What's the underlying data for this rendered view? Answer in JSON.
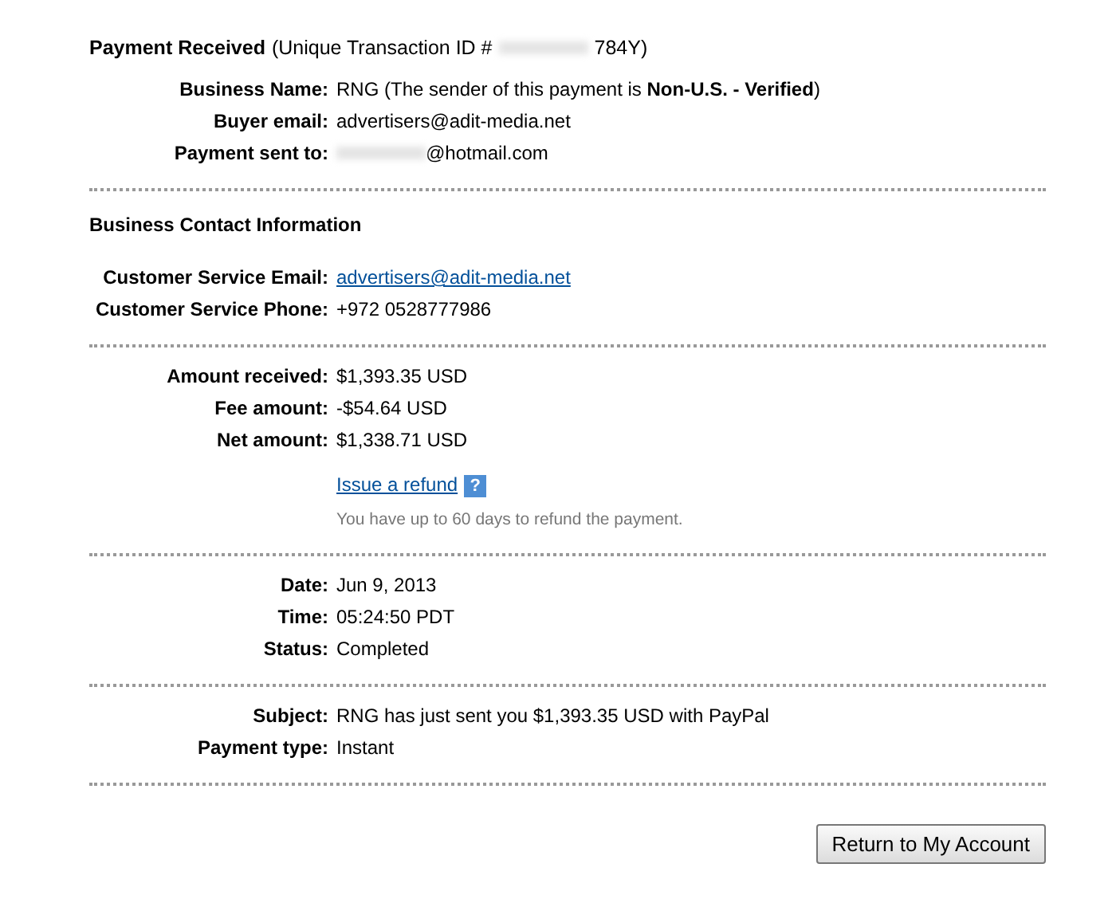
{
  "header": {
    "title": "Payment Received",
    "id_prefix": "(Unique Transaction ID #",
    "id_suffix": "784Y)"
  },
  "sections": [
    {
      "rows": [
        {
          "kind": "text",
          "label": "Business Name:",
          "value": "RNG (The sender of this payment is **Non-U.S. - Verified**)"
        },
        {
          "kind": "text",
          "label": "Buyer email:",
          "value": "advertisers@adit-media.net"
        },
        {
          "kind": "redacted",
          "label": "Payment sent to:",
          "value": "@hotmail.com"
        }
      ]
    },
    {
      "heading": "Business Contact Information",
      "rows": [
        {
          "kind": "link",
          "label": "Customer Service Email:",
          "value": "advertisers@adit-media.net"
        },
        {
          "kind": "text",
          "label": "Customer Service Phone:",
          "value": "+972 0528777986"
        }
      ]
    },
    {
      "rows": [
        {
          "kind": "text",
          "label": "Amount received:",
          "value": "$1,393.35 USD"
        },
        {
          "kind": "text",
          "label": "Fee amount:",
          "value": "-$54.64 USD"
        },
        {
          "kind": "text",
          "label": "Net amount:",
          "value": "$1,338.71 USD"
        },
        {
          "kind": "action",
          "link": "Issue a refund",
          "help": "?",
          "note": "You have up to 60 days to refund the payment."
        }
      ]
    },
    {
      "rows": [
        {
          "kind": "text",
          "label": "Date:",
          "value": "Jun 9, 2013"
        },
        {
          "kind": "text",
          "label": "Time:",
          "value": "05:24:50 PDT"
        },
        {
          "kind": "text",
          "label": "Status:",
          "value": "Completed"
        }
      ]
    },
    {
      "rows": [
        {
          "kind": "text",
          "label": "Subject:",
          "value": "RNG has just sent you $1,393.35 USD with PayPal"
        },
        {
          "kind": "text",
          "label": "Payment type:",
          "value": "Instant"
        }
      ]
    }
  ],
  "button": "Return to My Account"
}
